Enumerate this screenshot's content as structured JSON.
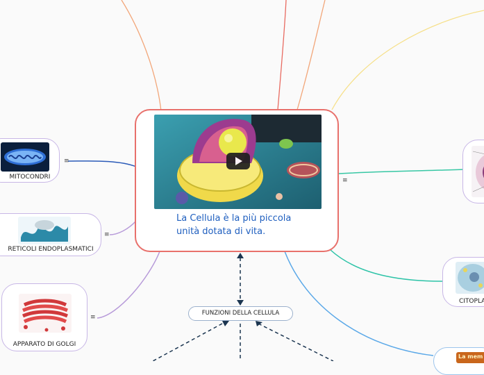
{
  "central": {
    "text": "La Cellula è la più piccola unità dotata di vita."
  },
  "nodes": {
    "mitocondri": "MITOCONDRI",
    "reticoli": "RETICOLI ENDOPLASMATICI",
    "golgi": "APPARATO DI GOLGI",
    "citoplasma": "CITOPLA",
    "funzioni": "FUNZIONI DELLA CELLULA",
    "partial_bottom_right": "La mem"
  },
  "collapse_markers": {
    "mitocondri": "≡",
    "reticoli": "≡",
    "golgi": "≡",
    "right_top": "≡"
  },
  "colors": {
    "central_border": "#e8706b",
    "central_text": "#1f5fbf",
    "node_border": "#c7b6e6"
  }
}
